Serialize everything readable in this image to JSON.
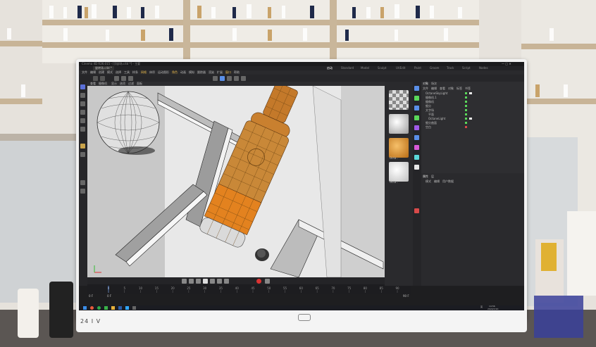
{
  "window": {
    "title": "Cinema 4D R26.015 - [顶部场.c4d *] - 主要",
    "tab": "旋转场.c4d *"
  },
  "menubar": {
    "items": [
      "文件",
      "编辑",
      "创建",
      "模式",
      "选择",
      "工具",
      "样条",
      "网格",
      "体积",
      "运动图形",
      "角色",
      "动画",
      "模拟",
      "跟踪器",
      "渲染",
      "扩展",
      "窗口",
      "帮助"
    ]
  },
  "layout_tabs": [
    "Standard",
    "Model",
    "Sculpt",
    "UVEdit",
    "Paint",
    "Groom",
    "Track",
    "Script",
    "Nodes"
  ],
  "active_layout": "启动",
  "viewport_menu": [
    "查看",
    "摄像机",
    "显示",
    "选项",
    "过滤",
    "面板"
  ],
  "material_panel": {
    "materials": [
      {
        "name": "",
        "color": "checker"
      },
      {
        "name": "",
        "color": "#c9c9c9"
      },
      {
        "name": "Octa..",
        "color": "#d9902e"
      },
      {
        "name": "Octa..",
        "color": "#e8e8e8"
      }
    ]
  },
  "object_manager": {
    "tabs": [
      "对象",
      "场次"
    ],
    "menu": [
      "文件",
      "编辑",
      "查看",
      "对象",
      "标签",
      "书签"
    ],
    "objects": [
      "OctaneSkyLight",
      "摄像机.1",
      "摄像机",
      "细分",
      "文字场",
      "平面",
      "OctaneLight",
      "细分曲面",
      "空白"
    ]
  },
  "attribute_manager": {
    "tabs": [
      "属性",
      "层"
    ],
    "menu": [
      "模式",
      "编辑",
      "用户数据"
    ]
  },
  "timeline": {
    "ticks": [
      "0",
      "5",
      "10",
      "15",
      "20",
      "25",
      "30",
      "35",
      "40",
      "45",
      "50",
      "55",
      "60",
      "65",
      "70",
      "75",
      "80",
      "85",
      "90"
    ],
    "current_frame": "0 F",
    "start": "0 F",
    "end": "90 F"
  },
  "taskbar": {
    "time": "14:56",
    "date": "2024/7/20",
    "lang": "英"
  },
  "monitor": {
    "brand": "24 I V"
  }
}
